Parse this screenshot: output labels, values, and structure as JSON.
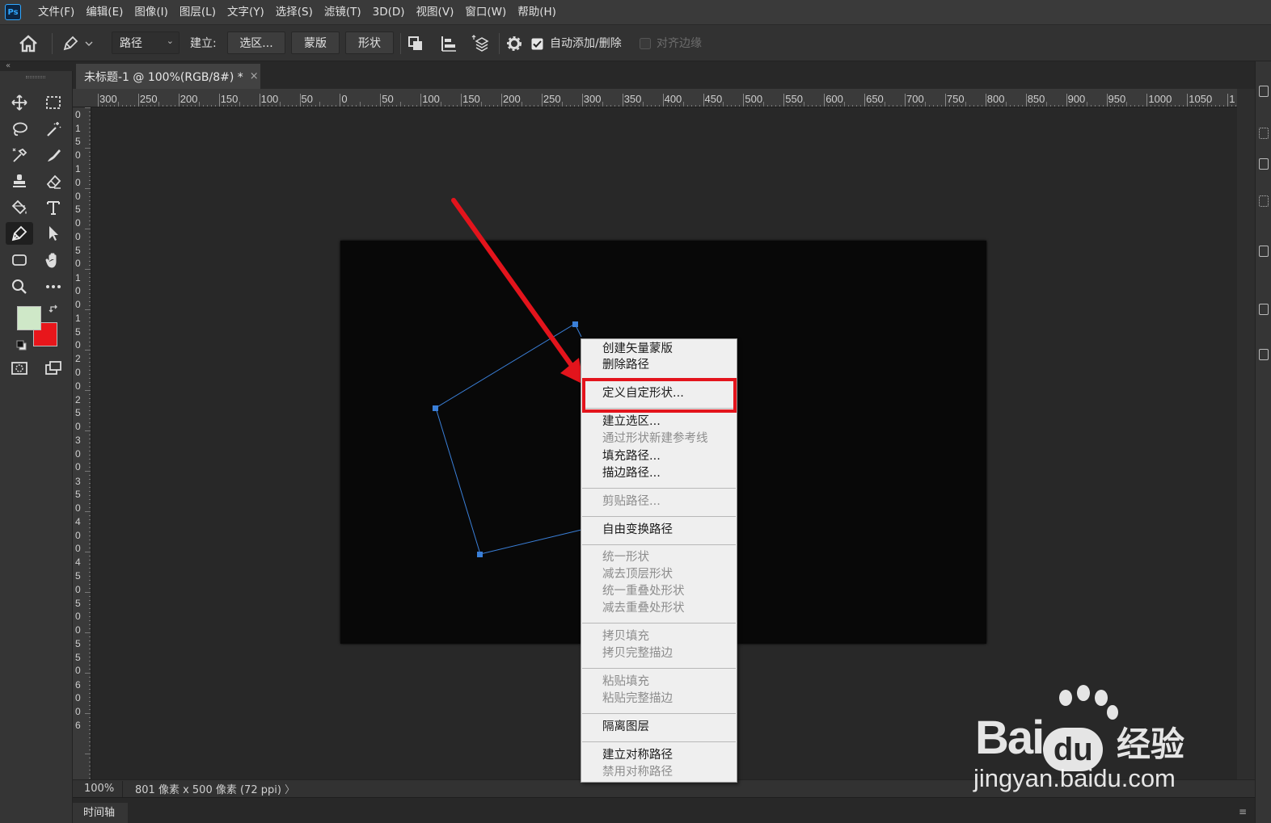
{
  "app": {
    "logo": "Ps",
    "menu": [
      "文件(F)",
      "编辑(E)",
      "图像(I)",
      "图层(L)",
      "文字(Y)",
      "选择(S)",
      "滤镜(T)",
      "3D(D)",
      "视图(V)",
      "窗口(W)",
      "帮助(H)"
    ]
  },
  "options_bar": {
    "mode_select": "路径",
    "make_label": "建立:",
    "selection_button": "选区...",
    "mask_button": "蒙版",
    "shape_button": "形状",
    "auto_add_delete_label": "自动添加/删除",
    "auto_add_delete_checked": true,
    "align_edges_label": "对齐边缘",
    "align_edges_checked": false
  },
  "document_tab": {
    "title": "未标题-1 @ 100%(RGB/8#) *",
    "close": "×"
  },
  "rulers": {
    "horizontal": [
      "300",
      "250",
      "200",
      "150",
      "100",
      "50",
      "0",
      "50",
      "100",
      "150",
      "200",
      "250",
      "300",
      "350",
      "400",
      "450",
      "500",
      "550",
      "600",
      "650",
      "700",
      "750",
      "800",
      "850",
      "900",
      "950",
      "1000",
      "1050",
      "1"
    ],
    "vertical": [
      "0",
      "1",
      "5",
      "0",
      "1",
      "0",
      "0",
      "5",
      "0",
      "0",
      "5",
      "0",
      "1",
      "0",
      "0",
      "1",
      "5",
      "0",
      "2",
      "0",
      "0",
      "2",
      "5",
      "0",
      "3",
      "0",
      "0",
      "3",
      "5",
      "0",
      "4",
      "0",
      "0",
      "4",
      "5",
      "0",
      "5",
      "0",
      "0",
      "5",
      "5",
      "0",
      "6",
      "0",
      "0",
      "6"
    ]
  },
  "colors": {
    "foreground": "#cfe8c8",
    "background": "#e8161b",
    "path_color": "#3a7fd8",
    "highlight": "#e3141c",
    "arrow": "#e3141c"
  },
  "context_menu": {
    "items": [
      {
        "label": "创建矢量蒙版",
        "disabled": false
      },
      {
        "label": "删除路径",
        "disabled": false
      },
      {
        "label": "定义自定形状...",
        "disabled": false,
        "highlighted": true
      },
      {
        "label": "建立选区...",
        "disabled": false
      },
      {
        "label": "通过形状新建参考线",
        "disabled": true
      },
      {
        "label": "填充路径...",
        "disabled": false
      },
      {
        "label": "描边路径...",
        "disabled": false
      },
      {
        "label": "剪贴路径...",
        "disabled": true
      },
      {
        "label": "自由变换路径",
        "disabled": false
      },
      {
        "label": "统一形状",
        "disabled": true
      },
      {
        "label": "减去顶层形状",
        "disabled": true
      },
      {
        "label": "统一重叠处形状",
        "disabled": true
      },
      {
        "label": "减去重叠处形状",
        "disabled": true
      },
      {
        "label": "拷贝填充",
        "disabled": true
      },
      {
        "label": "拷贝完整描边",
        "disabled": true
      },
      {
        "label": "粘贴填充",
        "disabled": true
      },
      {
        "label": "粘贴完整描边",
        "disabled": true
      },
      {
        "label": "隔离图层",
        "disabled": false
      },
      {
        "label": "建立对称路径",
        "disabled": false
      },
      {
        "label": "禁用对称路径",
        "disabled": true
      }
    ]
  },
  "status_bar": {
    "zoom": "100%",
    "doc_info": "801 像素 x 500 像素 (72 ppi)",
    "arrow": "〉"
  },
  "timeline": {
    "tab": "时间轴",
    "menu": "≡"
  },
  "watermark": {
    "brand": "Bai",
    "brand_cn": "经验",
    "url": "jingyan.baidu.com"
  }
}
